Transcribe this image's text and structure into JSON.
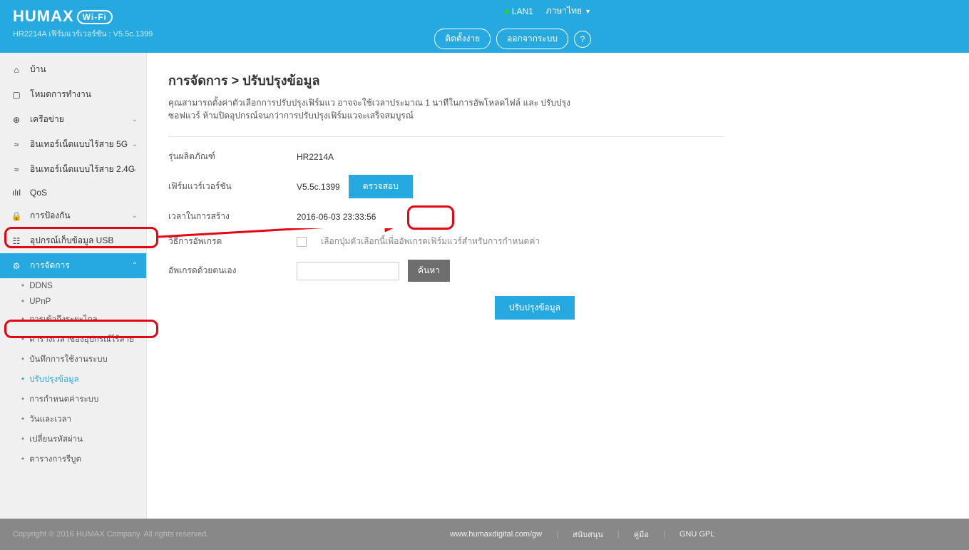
{
  "header": {
    "brand": "HUMAX",
    "wifi_badge": "Wi-Fi",
    "model_fw": "HR2214A เฟิร์มแวร์เวอร์ชัน : V5.5c.1399",
    "lan_status": "LAN1",
    "language": "ภาษาไทย",
    "easy_setup": "ติดตั้งง่าย",
    "logout": "ออกจากระบบ",
    "help": "?"
  },
  "nav": {
    "home": "บ้าน",
    "op_mode": "โหมดการทำงาน",
    "network": "เครือข่าย",
    "wifi5": "อินเทอร์เน็ตแบบไร้สาย 5G",
    "wifi24": "อินเทอร์เน็ตแบบไร้สาย 2.4G",
    "qos": "QoS",
    "security": "การป้องกัน",
    "usb": "อุปกรณ์เก็บข้อมูล USB",
    "management": "การจัดการ",
    "sub": {
      "ddns": "DDNS",
      "upnp": "UPnP",
      "remote": "การเข้าถึงระยะไกล",
      "sched": "ตารางเวลาของอุปกรณ์ไร้สาย",
      "syslog": "บันทึกการใช้งานระบบ",
      "upgrade": "ปรับปรุงข้อมูล",
      "config": "การกำหนดค่าระบบ",
      "datetime": "วันและเวลา",
      "password": "เปลี่ยนรหัสผ่าน",
      "reboot": "ตารางการรีบูต"
    }
  },
  "page": {
    "title": "การจัดการ > ปรับปรุงข้อมูล",
    "desc": "คุณสามารถตั้งค่าตัวเลือกการปรับปรุงเฟิร์มแว อาจจะใช้เวลาประมาณ 1 นาทีในการอัพโหลดไฟล์ และ ปรับปรุงซอฟแวร์ ห้ามปิดอุปกรณ์จนกว่าการปรับปรุงเฟิร์มแวจะเสร็จสมบูรณ์",
    "rows": {
      "model_label": "รุ่นผลิตภัณฑ์",
      "model_value": "HR2214A",
      "fw_label": "เฟิร์มแวร์เวอร์ชัน",
      "fw_value": "V5.5c.1399",
      "check_btn": "ตรวจสอบ",
      "build_label": "เวลาในการสร้าง",
      "build_value": "2016-06-03 23:33:56",
      "method_label": "วิธีการอัพเกรด",
      "method_checkbox": "เลือกปุ่มตัวเลือกนี้เพื่ออัพเกรดเฟิร์มแวร์สำหรับการกำหนดค่า",
      "manual_label": "อัพเกรดด้วยตนเอง",
      "browse_btn": "ค้นหา",
      "submit": "ปรับปรุงข้อมูล"
    }
  },
  "footer": {
    "copyright": "Copyright © 2016 HUMAX Company. All rights reserved.",
    "url": "www.humaxdigital.com/gw",
    "support": "สนับสนุน",
    "manual": "คู่มือ",
    "gpl": "GNU GPL"
  }
}
